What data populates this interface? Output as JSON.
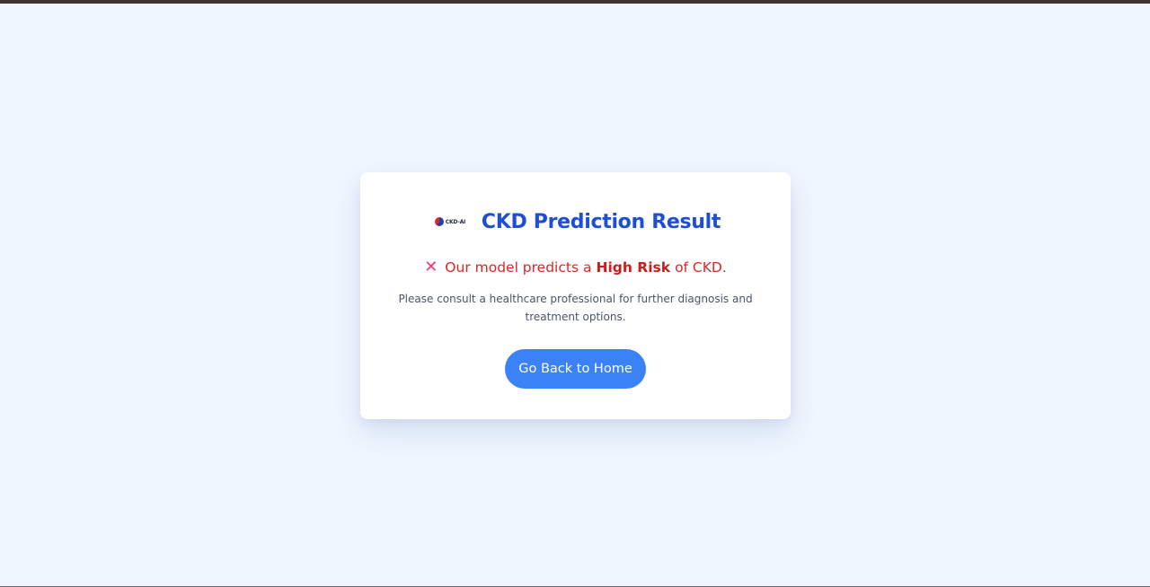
{
  "logo": {
    "text": "CKD-AI"
  },
  "result": {
    "title": "CKD Prediction Result",
    "icon": "cross-icon",
    "prefix": "Our model predicts a",
    "risk": "High Risk",
    "suffix": "of CKD.",
    "advice": "Please consult a healthcare professional for further diagnosis and treatment options."
  },
  "actions": {
    "home_label": "Go Back to Home"
  },
  "colors": {
    "background": "#eff6ff",
    "title": "#1d4ed8",
    "risk": "#dc2626",
    "button": "#3b82f6"
  }
}
